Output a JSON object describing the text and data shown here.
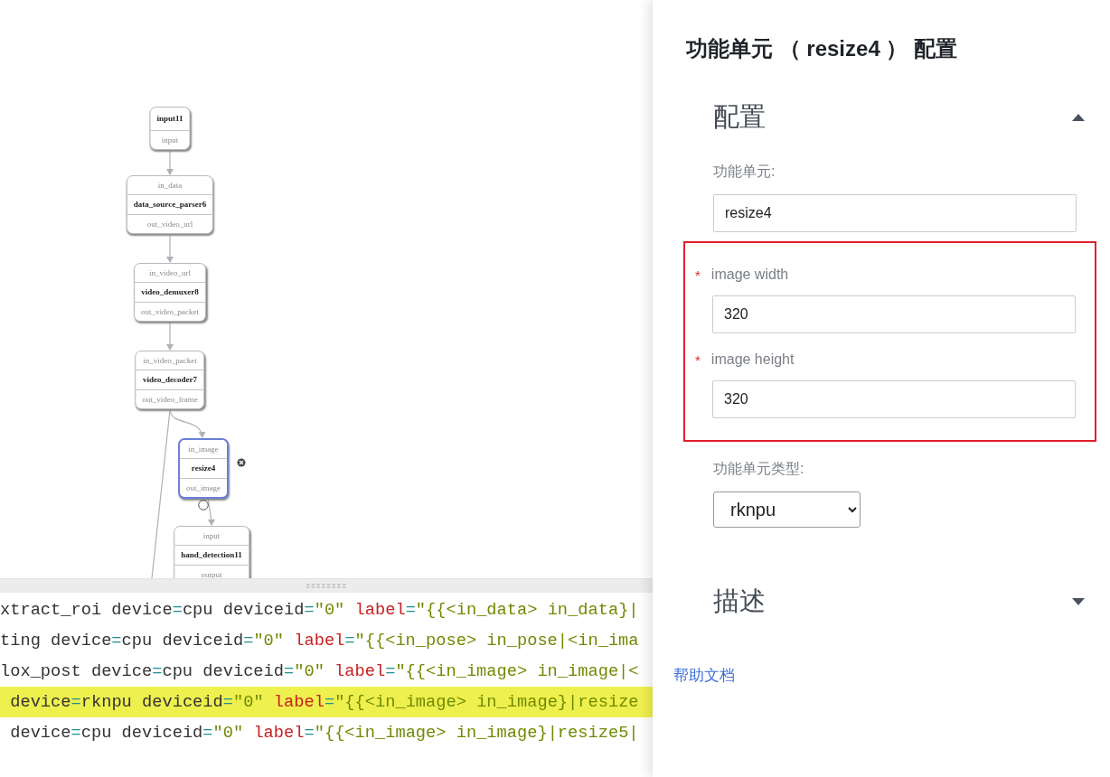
{
  "graph": {
    "nodes": [
      {
        "name": "input11",
        "out": "input",
        "selected": false
      },
      {
        "name": "data_source_parser6",
        "in": "in_data",
        "out": "out_video_url",
        "selected": false
      },
      {
        "name": "video_demuxer8",
        "in": "in_video_url",
        "out": "out_video_packet",
        "selected": false
      },
      {
        "name": "video_decoder7",
        "in": "in_video_packet",
        "out": "out_video_frame",
        "selected": false
      },
      {
        "name": "resize4",
        "in": "in_image",
        "out": "out_image",
        "selected": true
      },
      {
        "name": "hand_detection11",
        "in": "input",
        "out": "output",
        "selected": false
      }
    ]
  },
  "code": {
    "lines": [
      {
        "highlighted": false,
        "tokens": [
          {
            "kind": "text",
            "text": "xtract_roi device"
          },
          {
            "kind": "op",
            "text": "="
          },
          {
            "kind": "text",
            "text": "cpu deviceid"
          },
          {
            "kind": "op",
            "text": "="
          },
          {
            "kind": "str",
            "text": "\"0\""
          },
          {
            "kind": "key",
            "text": "label"
          },
          {
            "kind": "op",
            "text": "="
          },
          {
            "kind": "str",
            "text": "\"{{<in_data> in_data}|"
          }
        ]
      },
      {
        "highlighted": false,
        "tokens": [
          {
            "kind": "text",
            "text": "ting device"
          },
          {
            "kind": "op",
            "text": "="
          },
          {
            "kind": "text",
            "text": "cpu deviceid"
          },
          {
            "kind": "op",
            "text": "="
          },
          {
            "kind": "str",
            "text": "\"0\""
          },
          {
            "kind": "key",
            "text": "label"
          },
          {
            "kind": "op",
            "text": "="
          },
          {
            "kind": "str",
            "text": "\"{{<in_pose> in_pose|<in_ima"
          }
        ]
      },
      {
        "highlighted": false,
        "tokens": [
          {
            "kind": "text",
            "text": "lox_post device"
          },
          {
            "kind": "op",
            "text": "="
          },
          {
            "kind": "text",
            "text": "cpu deviceid"
          },
          {
            "kind": "op",
            "text": "="
          },
          {
            "kind": "str",
            "text": "\"0\""
          },
          {
            "kind": "key",
            "text": "label"
          },
          {
            "kind": "op",
            "text": "="
          },
          {
            "kind": "str",
            "text": "\"{{<in_image> in_image|<"
          }
        ]
      },
      {
        "highlighted": true,
        "tokens": [
          {
            "kind": "text",
            "text": " device"
          },
          {
            "kind": "op",
            "text": "="
          },
          {
            "kind": "text",
            "text": "rknpu deviceid"
          },
          {
            "kind": "op",
            "text": "="
          },
          {
            "kind": "str",
            "text": "\"0\""
          },
          {
            "kind": "key",
            "text": "label"
          },
          {
            "kind": "op",
            "text": "="
          },
          {
            "kind": "str",
            "text": "\"{{<in_image> in_image}|resize"
          }
        ]
      },
      {
        "highlighted": false,
        "tokens": [
          {
            "kind": "text",
            "text": " device"
          },
          {
            "kind": "op",
            "text": "="
          },
          {
            "kind": "text",
            "text": "cpu deviceid"
          },
          {
            "kind": "op",
            "text": "="
          },
          {
            "kind": "str",
            "text": "\"0\""
          },
          {
            "kind": "key",
            "text": "label"
          },
          {
            "kind": "op",
            "text": "="
          },
          {
            "kind": "str",
            "text": "\"{{<in_image> in_image}|resize5|"
          }
        ]
      }
    ]
  },
  "config_panel": {
    "title": "功能单元 （ resize4 ） 配置",
    "sections": [
      {
        "title": "配置",
        "expanded": true,
        "fields": [
          {
            "kind": "text",
            "label": "功能单元:",
            "value": "resize4"
          },
          {
            "kind": "text",
            "required_mark": "*",
            "label": "image width",
            "value": "320"
          },
          {
            "kind": "text",
            "required_mark": "*",
            "label": "image height",
            "value": "320"
          },
          {
            "kind": "select",
            "label": "功能单元类型:",
            "value": "rknpu"
          }
        ]
      },
      {
        "title": "描述",
        "expanded": false
      }
    ],
    "help_link": "帮助文档"
  }
}
